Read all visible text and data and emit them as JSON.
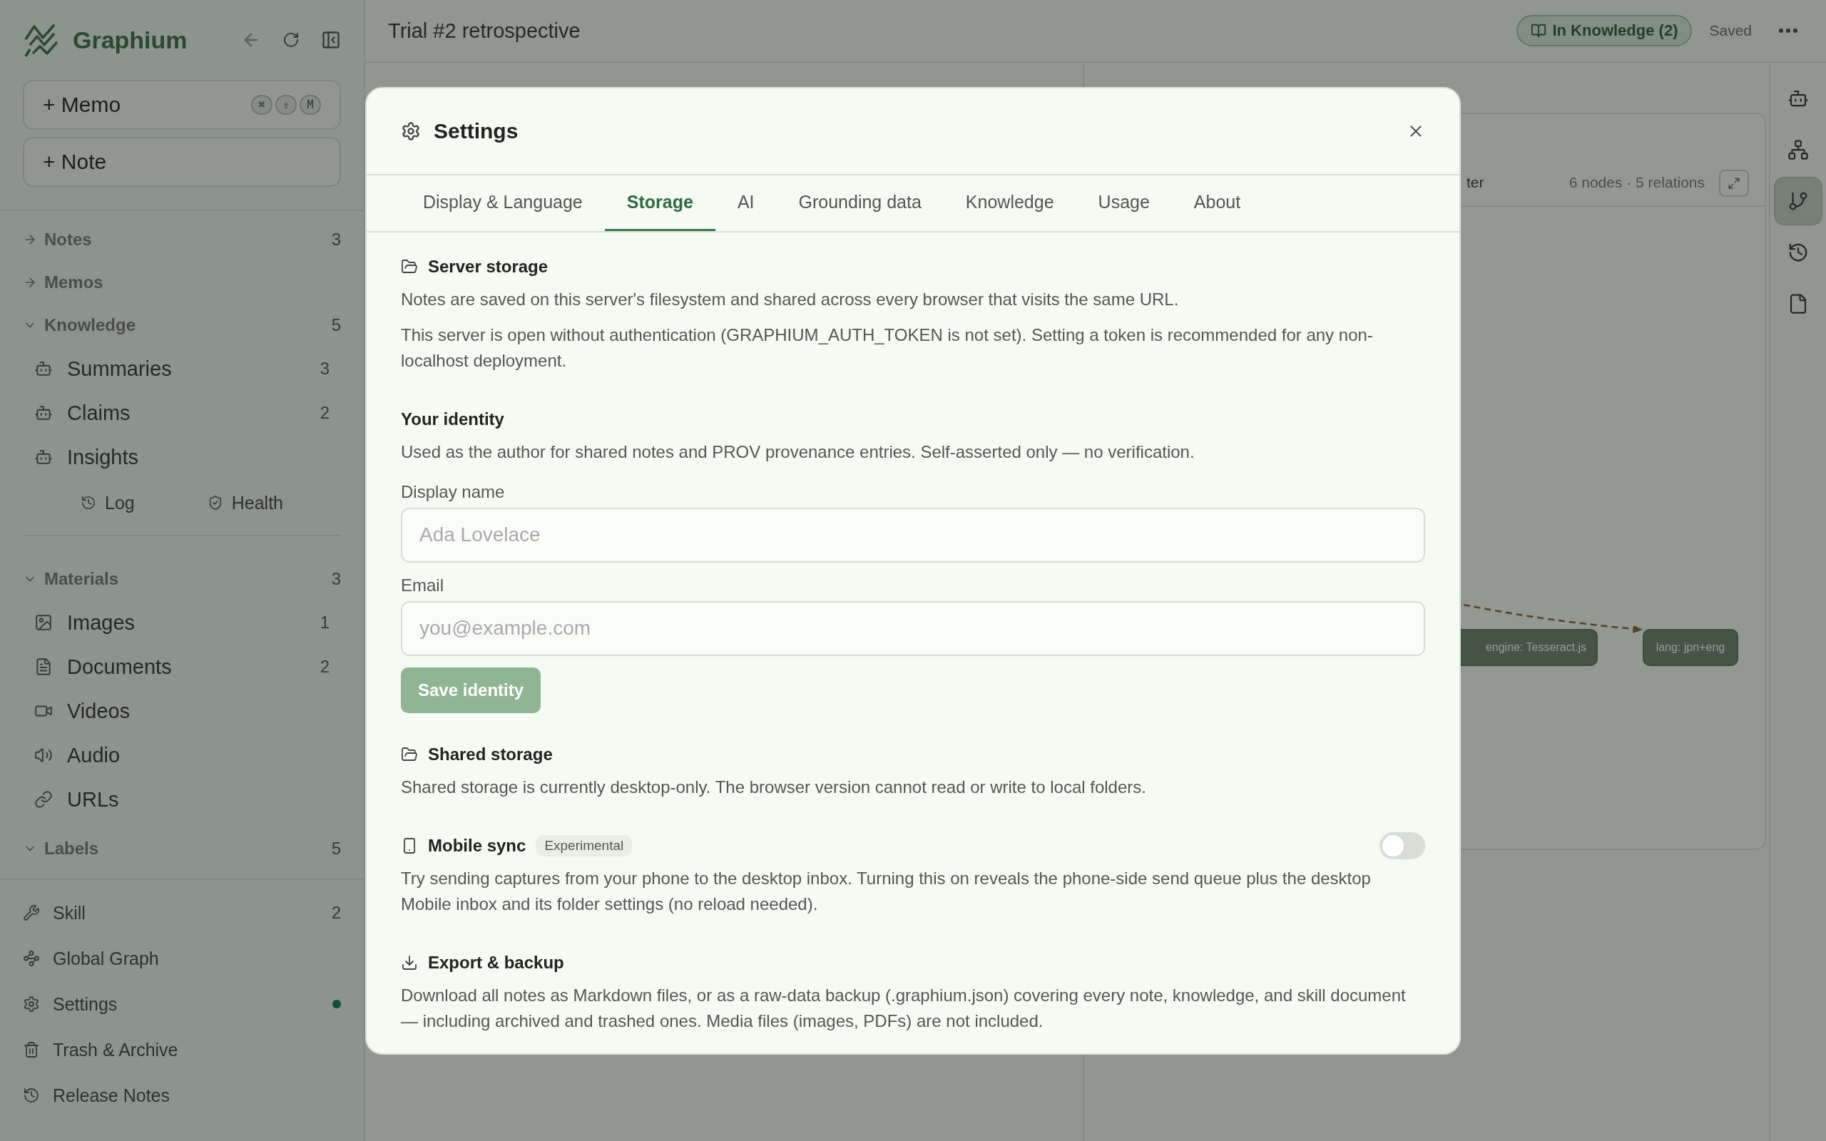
{
  "sidebar": {
    "brand": "Graphium",
    "new_buttons": [
      {
        "label": "+ Memo",
        "shortcut": [
          "⌘",
          "⇧",
          "M"
        ]
      },
      {
        "label": "+ Note"
      }
    ],
    "nav_groups": [
      {
        "sections": [
          {
            "label": "Notes",
            "expanded": false,
            "count": "3"
          },
          {
            "label": "Memos",
            "expanded": false
          },
          {
            "label": "Knowledge",
            "expanded": true,
            "count": "5",
            "items": [
              {
                "kind": "bot",
                "label": "Summaries",
                "count": "3"
              },
              {
                "kind": "bot",
                "label": "Claims",
                "count": "2"
              },
              {
                "kind": "bot",
                "label": "Insights"
              }
            ],
            "links": [
              {
                "kind": "history",
                "label": "Log"
              },
              {
                "kind": "shield",
                "label": "Health"
              }
            ]
          }
        ]
      },
      {
        "sections": [
          {
            "label": "Materials",
            "expanded": true,
            "count": "3",
            "items": [
              {
                "kind": "image",
                "label": "Images",
                "count": "1"
              },
              {
                "kind": "document",
                "label": "Documents",
                "count": "2"
              },
              {
                "kind": "video",
                "label": "Videos"
              },
              {
                "kind": "audio",
                "label": "Audio"
              },
              {
                "kind": "link",
                "label": "URLs"
              }
            ]
          },
          {
            "label": "Labels",
            "expanded": true,
            "count": "5"
          }
        ]
      }
    ],
    "footer": [
      {
        "kind": "wrench",
        "label": "Skill",
        "count": "2",
        "notified": false
      },
      {
        "kind": "graph",
        "label": "Global Graph",
        "notified": false
      },
      {
        "kind": "settings",
        "label": "Settings",
        "notified": true
      },
      {
        "kind": "trash",
        "label": "Trash & Archive",
        "notified": false
      },
      {
        "kind": "history",
        "label": "Release Notes",
        "notified": false
      }
    ]
  },
  "header": {
    "title": "Trial #2 retrospective",
    "badge": "In Knowledge (2)",
    "status": "Saved"
  },
  "graph": {
    "filter_fragment": "ter",
    "meta": "6 nodes · 5 relations",
    "nodes": [
      {
        "label": "engine: Tesseract.js"
      },
      {
        "label": "lang: jpn+eng"
      }
    ]
  },
  "rail": [
    {
      "kind": "bot",
      "selected": false
    },
    {
      "kind": "hierarchy",
      "selected": false
    },
    {
      "kind": "branch",
      "selected": true
    },
    {
      "kind": "history",
      "selected": false
    },
    {
      "kind": "file",
      "selected": false
    }
  ],
  "modal": {
    "title": "Settings",
    "tabs": [
      {
        "label": "Display & Language",
        "selected": false
      },
      {
        "label": "Storage",
        "selected": true
      },
      {
        "label": "AI",
        "selected": false
      },
      {
        "label": "Grounding data",
        "selected": false
      },
      {
        "label": "Knowledge",
        "selected": false
      },
      {
        "label": "Usage",
        "selected": false
      },
      {
        "label": "About",
        "selected": false
      }
    ],
    "sections": [
      {
        "kind": "folder",
        "title": "Server storage",
        "paragraphs": [
          "Notes are saved on this server's filesystem and shared across every browser that visits the same URL.",
          "This server is open without authentication (GRAPHIUM_AUTH_TOKEN is not set). Setting a token is recommended for any non-localhost deployment."
        ]
      },
      {
        "kind": "identity",
        "title": "Your identity",
        "paragraphs": [
          "Used as the author for shared notes and PROV provenance entries. Self-asserted only — no verification."
        ],
        "fields": [
          {
            "label": "Display name",
            "placeholder": "Ada Lovelace"
          },
          {
            "label": "Email",
            "placeholder": "you@example.com"
          }
        ],
        "button": {
          "label": "Save identity",
          "disabled": true
        }
      },
      {
        "kind": "folder",
        "title": "Shared storage",
        "paragraphs": [
          "Shared storage is currently desktop-only. The browser version cannot read or write to local folders."
        ]
      },
      {
        "kind": "phone",
        "title": "Mobile sync",
        "tag": "Experimental",
        "toggle": {
          "on": false
        },
        "paragraphs": [
          "Try sending captures from your phone to the desktop inbox. Turning this on reveals the phone-side send queue plus the desktop Mobile inbox and its folder settings (no reload needed)."
        ]
      },
      {
        "kind": "download",
        "title": "Export & backup",
        "paragraphs": [
          "Download all notes as Markdown files, or as a raw-data backup (.graphium.json) covering every note, knowledge, and skill document — including archived and trashed ones. Media files (images, PDFs) are not included."
        ]
      }
    ]
  }
}
